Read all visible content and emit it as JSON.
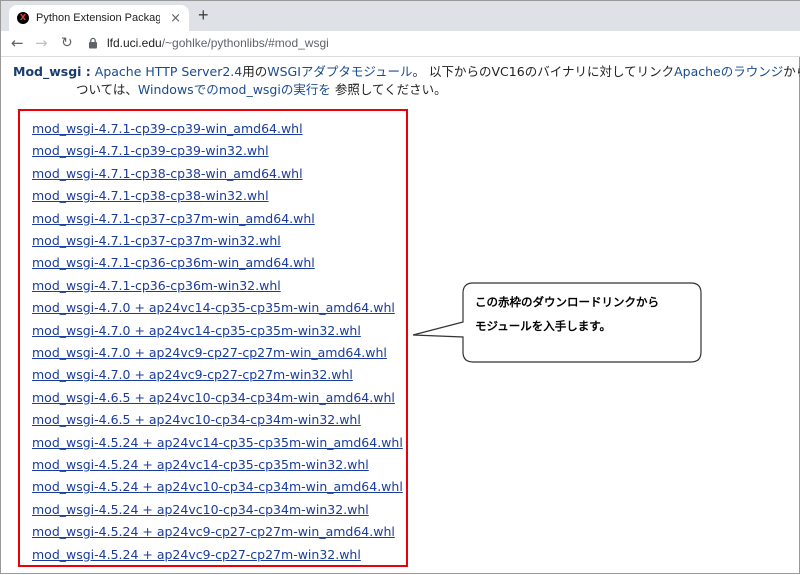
{
  "browser": {
    "tab_title": "Python Extension Packages for W",
    "tab_favicon": "X",
    "tab_close": "×",
    "new_tab": "+",
    "url_host": "lfd.uci.edu",
    "url_path": "/~gohlke/pythonlibs/#mod_wsgi"
  },
  "intro": {
    "heading": "Mod_wsgi :",
    "line1_link1": "Apache HTTP Server2.4",
    "line1_text1": "用の",
    "line1_link2": "WSGIアダプタモジュール",
    "line1_text2": "。 以下からのVC16のバイナリに対してリンク",
    "line1_link3": "Apacheのラウンジ",
    "line1_text3": "からとVC",
    "line2_text1": "ついては、",
    "line2_link1": "Windowsでのmod_wsgiの実行を",
    "line2_text2": " 参照してください。"
  },
  "downloads": [
    "mod_wsgi-4.7.1-cp39-cp39-win_amd64.whl",
    "mod_wsgi-4.7.1-cp39-cp39-win32.whl",
    "mod_wsgi-4.7.1-cp38-cp38-win_amd64.whl",
    "mod_wsgi-4.7.1-cp38-cp38-win32.whl",
    "mod_wsgi-4.7.1-cp37-cp37m-win_amd64.whl",
    "mod_wsgi-4.7.1-cp37-cp37m-win32.whl",
    "mod_wsgi-4.7.1-cp36-cp36m-win_amd64.whl",
    "mod_wsgi-4.7.1-cp36-cp36m-win32.whl",
    "mod_wsgi-4.7.0 + ap24vc14-cp35-cp35m-win_amd64.whl",
    "mod_wsgi-4.7.0 + ap24vc14-cp35-cp35m-win32.whl",
    "mod_wsgi-4.7.0 + ap24vc9-cp27-cp27m-win_amd64.whl",
    "mod_wsgi-4.7.0 + ap24vc9-cp27-cp27m-win32.whl",
    "mod_wsgi-4.6.5 + ap24vc10-cp34-cp34m-win_amd64.whl",
    "mod_wsgi-4.6.5 + ap24vc10-cp34-cp34m-win32.whl",
    "mod_wsgi-4.5.24 + ap24vc14-cp35-cp35m-win_amd64.whl",
    "mod_wsgi-4.5.24 + ap24vc14-cp35-cp35m-win32.whl",
    "mod_wsgi-4.5.24 + ap24vc10-cp34-cp34m-win_amd64.whl",
    "mod_wsgi-4.5.24 + ap24vc10-cp34-cp34m-win32.whl",
    "mod_wsgi-4.5.24 + ap24vc9-cp27-cp27m-win_amd64.whl",
    "mod_wsgi-4.5.24 + ap24vc9-cp27-cp27m-win32.whl"
  ],
  "callout": {
    "line1": "この赤枠のダウンロードリンクから",
    "line2": "モジュールを入手します。"
  },
  "colors": {
    "highlight_border": "#e8000b",
    "link": "#1a3c9c"
  }
}
